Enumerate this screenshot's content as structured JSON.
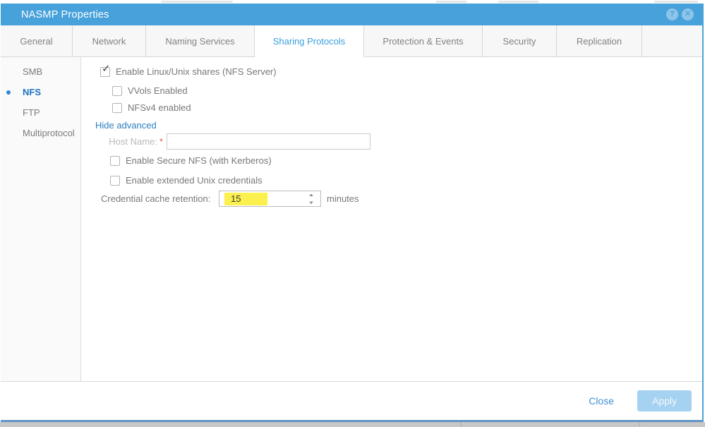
{
  "dialog": {
    "title": "NASMP Properties",
    "titlebar_icons": {
      "help": "?",
      "close": "✕"
    },
    "tabs": [
      {
        "label": "General",
        "active": false
      },
      {
        "label": "Network",
        "active": false
      },
      {
        "label": "Naming Services",
        "active": false
      },
      {
        "label": "Sharing Protocols",
        "active": true
      },
      {
        "label": "Protection & Events",
        "active": false
      },
      {
        "label": "Security",
        "active": false
      },
      {
        "label": "Replication",
        "active": false
      }
    ],
    "sidebar": {
      "items": [
        {
          "label": "SMB",
          "selected": false
        },
        {
          "label": "NFS",
          "selected": true
        },
        {
          "label": "FTP",
          "selected": false
        },
        {
          "label": "Multiprotocol",
          "selected": false
        }
      ]
    },
    "content": {
      "enable_nfs": {
        "label": "Enable Linux/Unix shares (NFS Server)",
        "checked": true
      },
      "vvols": {
        "label": "VVols Enabled",
        "checked": false
      },
      "nfsv4": {
        "label": "NFSv4 enabled",
        "checked": false
      },
      "advanced_toggle": {
        "label": "Hide advanced"
      },
      "host_name": {
        "label": "Host Name:",
        "required_marker": "*",
        "value": ""
      },
      "secure_nfs": {
        "label": "Enable Secure NFS (with Kerberos)",
        "checked": false
      },
      "extended_unix": {
        "label": "Enable extended Unix credentials",
        "checked": false
      },
      "cache_retention": {
        "label": "Credential cache retention:",
        "value": "15",
        "unit": "minutes"
      }
    },
    "footer": {
      "close_label": "Close",
      "apply_label": "Apply",
      "apply_disabled": true
    },
    "icons": {
      "check": "✓",
      "spinner_up": "▲",
      "spinner_down": "▼"
    },
    "colors": {
      "titlebar_blue": "#47a1db",
      "active_tab_blue": "#3b9edd",
      "selected_item_blue": "#1f72c4",
      "link_blue": "#2b80c5",
      "required_red": "#e05b5b",
      "value_highlight_yellow": "#fbf04e",
      "apply_disabled_blue": "#a5d2f0"
    }
  }
}
